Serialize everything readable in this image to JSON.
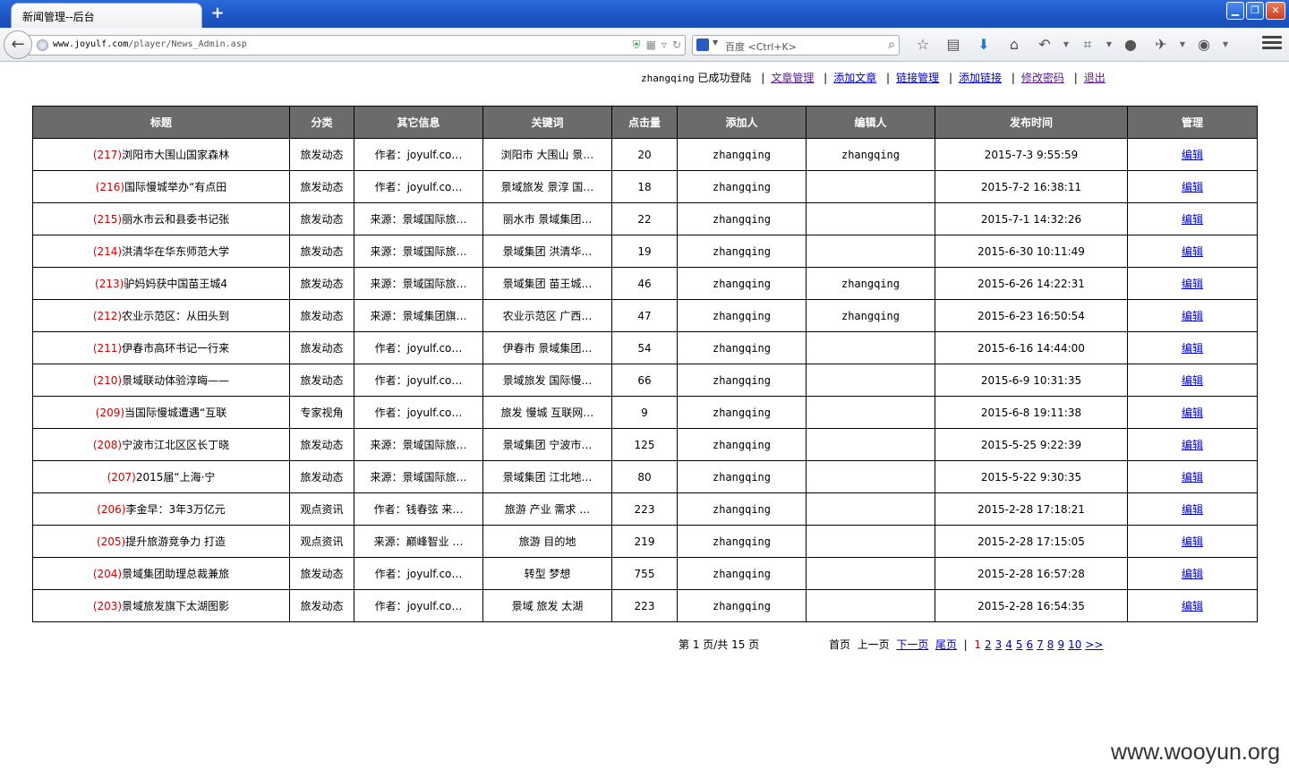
{
  "browser": {
    "tab_title": "新闻管理--后台",
    "url_host": "www.joyulf.com",
    "url_path": "/player/News_Admin.asp",
    "search_placeholder": "百度 <Ctrl+K>"
  },
  "userbar": {
    "username": "zhangqing",
    "status": " 已成功登陆",
    "links": [
      "文章管理",
      "添加文章",
      "链接管理",
      "添加链接",
      "修改密码",
      "退出"
    ]
  },
  "table": {
    "headers": [
      "标题",
      "分类",
      "其它信息",
      "关键词",
      "点击量",
      "添加人",
      "编辑人",
      "发布时间",
      "管理"
    ],
    "rows": [
      {
        "id": "(217)",
        "title": "浏阳市大围山国家森林",
        "category": "旅发动态",
        "info": "作者：joyulf.co…",
        "keywords": "浏阳市 大围山 景…",
        "clicks": "20",
        "adder": "zhangqing",
        "editor": "zhangqing",
        "time": "2015-7-3 9:55:59",
        "action": "编辑"
      },
      {
        "id": "(216)",
        "title": "国际慢城举办“有点田",
        "category": "旅发动态",
        "info": "作者：joyulf.co…",
        "keywords": "景域旅发 景淳 国…",
        "clicks": "18",
        "adder": "zhangqing",
        "editor": "",
        "time": "2015-7-2 16:38:11",
        "action": "编辑"
      },
      {
        "id": "(215)",
        "title": "丽水市云和县委书记张",
        "category": "旅发动态",
        "info": "来源：景域国际旅…",
        "keywords": "丽水市 景域集团…",
        "clicks": "22",
        "adder": "zhangqing",
        "editor": "",
        "time": "2015-7-1 14:32:26",
        "action": "编辑"
      },
      {
        "id": "(214)",
        "title": "洪清华在华东师范大学",
        "category": "旅发动态",
        "info": "来源：景域国际旅…",
        "keywords": "景域集团 洪清华…",
        "clicks": "19",
        "adder": "zhangqing",
        "editor": "",
        "time": "2015-6-30 10:11:49",
        "action": "编辑"
      },
      {
        "id": "(213)",
        "title": "驴妈妈获中国苗王城4",
        "category": "旅发动态",
        "info": "来源：景域国际旅…",
        "keywords": "景域集团 苗王城…",
        "clicks": "46",
        "adder": "zhangqing",
        "editor": "zhangqing",
        "time": "2015-6-26 14:22:31",
        "action": "编辑"
      },
      {
        "id": "(212)",
        "title": "农业示范区：从田头到",
        "category": "旅发动态",
        "info": "来源：景域集团旗…",
        "keywords": "农业示范区 广西…",
        "clicks": "47",
        "adder": "zhangqing",
        "editor": "zhangqing",
        "time": "2015-6-23 16:50:54",
        "action": "编辑"
      },
      {
        "id": "(211)",
        "title": "伊春市高环书记一行来",
        "category": "旅发动态",
        "info": "作者：joyulf.co…",
        "keywords": "伊春市 景域集团…",
        "clicks": "54",
        "adder": "zhangqing",
        "editor": "",
        "time": "2015-6-16 14:44:00",
        "action": "编辑"
      },
      {
        "id": "(210)",
        "title": "景域联动体验淳晦——",
        "category": "旅发动态",
        "info": "作者：joyulf.co…",
        "keywords": "景域旅发 国际慢…",
        "clicks": "66",
        "adder": "zhangqing",
        "editor": "",
        "time": "2015-6-9 10:31:35",
        "action": "编辑"
      },
      {
        "id": "(209)",
        "title": "当国际慢城遭遇“互联",
        "category": "专家视角",
        "info": "作者：joyulf.co…",
        "keywords": "旅发 慢城 互联网…",
        "clicks": "9",
        "adder": "zhangqing",
        "editor": "",
        "time": "2015-6-8 19:11:38",
        "action": "编辑"
      },
      {
        "id": "(208)",
        "title": "宁波市江北区区长丁晓",
        "category": "旅发动态",
        "info": "来源：景域国际旅…",
        "keywords": "景域集团 宁波市…",
        "clicks": "125",
        "adder": "zhangqing",
        "editor": "",
        "time": "2015-5-25 9:22:39",
        "action": "编辑"
      },
      {
        "id": "(207)",
        "title": "2015届“上海·宁",
        "category": "旅发动态",
        "info": "来源：景域国际旅…",
        "keywords": "景域集团 江北地…",
        "clicks": "80",
        "adder": "zhangqing",
        "editor": "",
        "time": "2015-5-22 9:30:35",
        "action": "编辑"
      },
      {
        "id": "(206)",
        "title": "李金早：3年3万亿元",
        "category": "观点资讯",
        "info": "作者：钱春弦 来…",
        "keywords": "旅游 产业 需求 …",
        "clicks": "223",
        "adder": "zhangqing",
        "editor": "",
        "time": "2015-2-28 17:18:21",
        "action": "编辑"
      },
      {
        "id": "(205)",
        "title": "提升旅游竞争力 打造",
        "category": "观点资讯",
        "info": "来源：巅峰智业 …",
        "keywords": "旅游 目的地",
        "clicks": "219",
        "adder": "zhangqing",
        "editor": "",
        "time": "2015-2-28 17:15:05",
        "action": "编辑"
      },
      {
        "id": "(204)",
        "title": "景域集团助理总裁兼旅",
        "category": "旅发动态",
        "info": "作者：joyulf.co…",
        "keywords": "转型 梦想",
        "clicks": "755",
        "adder": "zhangqing",
        "editor": "",
        "time": "2015-2-28 16:57:28",
        "action": "编辑"
      },
      {
        "id": "(203)",
        "title": "景域旅发旗下太湖图影",
        "category": "旅发动态",
        "info": "作者：joyulf.co…",
        "keywords": "景域 旅发 太湖",
        "clicks": "223",
        "adder": "zhangqing",
        "editor": "",
        "time": "2015-2-28 16:54:35",
        "action": "编辑"
      }
    ]
  },
  "pager": {
    "info": "第 1 页/共 15 页",
    "first": "首页",
    "prev": "上一页",
    "next": "下一页",
    "last": "尾页",
    "current": "1",
    "pages": [
      "2",
      "3",
      "4",
      "5",
      "6",
      "7",
      "8",
      "9",
      "10"
    ],
    "more": ">>"
  },
  "watermark": "www.wooyun.org"
}
